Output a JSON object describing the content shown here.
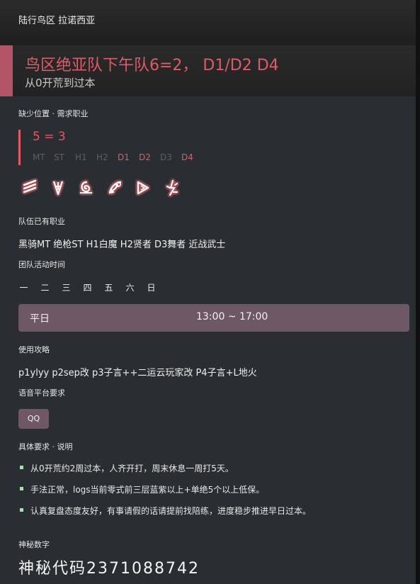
{
  "window": {
    "title": "陆行鸟区 拉诺西亚"
  },
  "header": {
    "title": "鸟区绝亚队下午队6=2， D1/D2 D4",
    "subtitle": "从0开荒到过本"
  },
  "missing": {
    "label": "缺少位置 · 需求职业",
    "count": "5 = 3",
    "roles": [
      {
        "name": "MT",
        "needed": false
      },
      {
        "name": "ST",
        "needed": false
      },
      {
        "name": "H1",
        "needed": false
      },
      {
        "name": "H2",
        "needed": false
      },
      {
        "name": "D1",
        "needed": true
      },
      {
        "name": "D2",
        "needed": true
      },
      {
        "name": "D3",
        "needed": false
      },
      {
        "name": "D4",
        "needed": true
      }
    ],
    "job_icons": [
      "monk-job-icon",
      "dragoon-job-icon",
      "ninja-job-icon",
      "samurai-job-icon",
      "reaper-job-icon",
      "viper-job-icon"
    ],
    "accent_color": "#e05a68"
  },
  "party": {
    "label": "队伍已有职业",
    "jobs": "黑骑MT 绝枪ST H1白魔 H2贤者 D3舞者 近战武士"
  },
  "schedule": {
    "label": "团队活动时间",
    "days": [
      "一",
      "二",
      "三",
      "四",
      "五",
      "六",
      "日"
    ],
    "bar_label": "平日",
    "bar_time": "13:00 ~ 17:00"
  },
  "strategy": {
    "label": "使用攻略",
    "text": "p1ylyy p2sep改 p3子言++二运云玩家改 P4子言+L地火"
  },
  "voice": {
    "label": "语音平台要求",
    "button": "QQ"
  },
  "details": {
    "label": "具体要求 · 说明",
    "items": [
      "从0开荒约2周过本，人齐开打，周末休息一周打5天。",
      "手法正常，logs当前零式前三层蓝紫以上+单绝5个以上低保。",
      "认真复盘态度友好，有事请假的话请提前找陪练，进度稳步推进早日过本。"
    ],
    "bullet_color": "#9fe7a8"
  },
  "secret": {
    "label": "神秘数字",
    "text": "神秘代码2371088742"
  }
}
